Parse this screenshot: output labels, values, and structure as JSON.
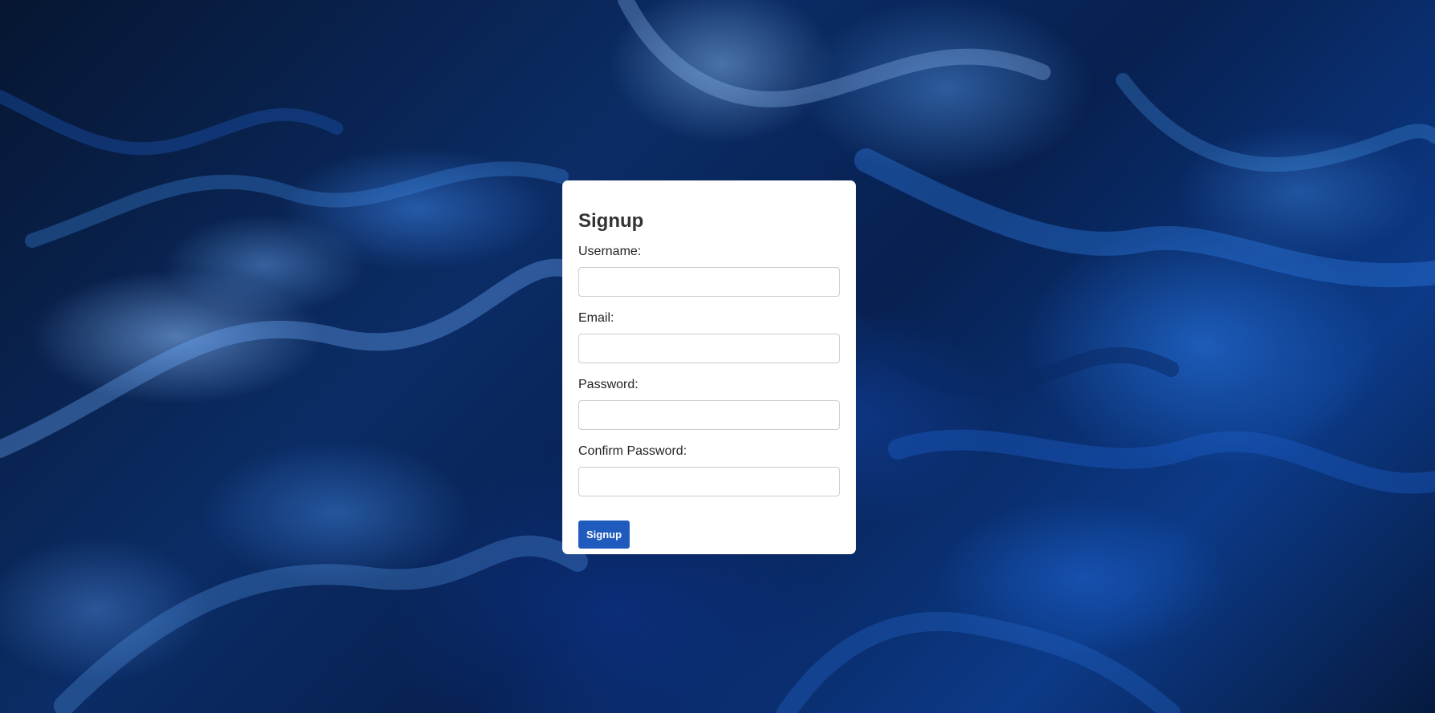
{
  "background": {
    "description_icon": "abstract-marble-background",
    "base_color": "#0b2c66",
    "accent_color": "#4a9af0"
  },
  "form": {
    "title": "Signup",
    "fields": [
      {
        "label": "Username:",
        "value": "",
        "placeholder": ""
      },
      {
        "label": "Email:",
        "value": "",
        "placeholder": ""
      },
      {
        "label": "Password:",
        "value": "",
        "placeholder": ""
      },
      {
        "label": "Confirm Password:",
        "value": "",
        "placeholder": ""
      }
    ],
    "submit_label": "Signup",
    "submit_color": "#1f5bbd"
  }
}
